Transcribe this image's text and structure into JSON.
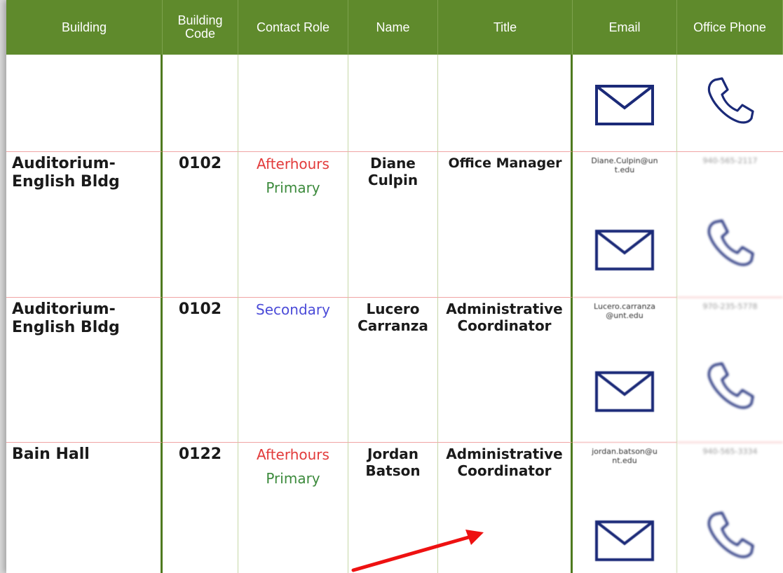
{
  "table": {
    "headers": {
      "building": "Building",
      "code_line1": "Building",
      "code_line2": "Code",
      "contact_role": "Contact Role",
      "name": "Name",
      "title": "Title",
      "email": "Email",
      "office_phone": "Office Phone"
    },
    "rows": [
      {
        "building": "",
        "code": "",
        "role_line1": "",
        "role_line2": "",
        "name_line1": "",
        "name_line2": "",
        "title_line1": "",
        "title_line2": "",
        "email_line1": "",
        "email_line2": "",
        "phone": ""
      },
      {
        "building_line1": "Auditorium-",
        "building_line2": "English Bldg",
        "code": "0102",
        "role_line1": "Afterhours",
        "role_line2": "Primary",
        "name_line1": "Diane",
        "name_line2": "Culpin",
        "title_line1": "Office Manager",
        "email_line1": "Diane.Culpin@un",
        "email_line2": "t.edu",
        "phone": "940-565-2117"
      },
      {
        "building_line1": "Auditorium-",
        "building_line2": "English Bldg",
        "code": "0102",
        "role_line1": "Secondary",
        "name_line1": "Lucero",
        "name_line2": "Carranza",
        "title_line1": "Administrative",
        "title_line2": "Coordinator",
        "email_line1": "Lucero.carranza",
        "email_line2": "@unt.edu",
        "phone": "970-235-5778"
      },
      {
        "building_line1": "Bain Hall",
        "code": "0122",
        "role_line1": "Afterhours",
        "role_line2": "Primary",
        "name_line1": "Jordan",
        "name_line2": "Batson",
        "title_line1": "Administrative",
        "title_line2": "Coordinator",
        "email_line1": "jordan.batson@u",
        "email_line2": "nt.edu",
        "phone": "940-565-3334"
      }
    ]
  },
  "icons": {
    "email": "envelope-icon",
    "phone": "phone-handset-icon"
  },
  "colors": {
    "header_bg": "#5f8a2c",
    "role_afterhours": "#e23b3b",
    "role_primary": "#3c8a3c",
    "role_secondary": "#4b4bd8",
    "icon_stroke": "#1b2a78",
    "annotation_arrow": "#ee1111"
  }
}
